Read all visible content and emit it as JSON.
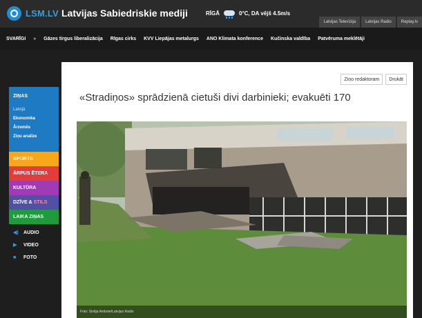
{
  "header": {
    "logo_text": "LSM.LV",
    "site_title": "Latvijas Sabiedriskie mediji",
    "weather_city": "RĪGĀ",
    "weather_info": "0°C, DA vējš 4.5m/s",
    "nav": [
      "Latvijas Televīzija",
      "Latvijas Radio",
      "Replay.lv"
    ]
  },
  "ticker": {
    "label": "SVARĪGI",
    "separator": "»",
    "items": [
      "Gāzes tirgus liberalizācija",
      "Rīgas cirks",
      "KVV Liepājas metalurgs",
      "ANO Klimata konference",
      "Kučinska valdība",
      "Patvēruma meklētāji"
    ]
  },
  "sidebar": {
    "zinas": "ZIŅAS",
    "zinas_sub": [
      "Latvijā",
      "Ekonomika",
      "Ārzemēs",
      "Ziņu analīze"
    ],
    "sports": "SPORTS",
    "arpus": "ĀRPUS ĒTERA",
    "kultura": "KULTŪRA",
    "dzive": "DZĪVE & ",
    "stils": "STILS",
    "laika": "LAIKA ZIŅAS",
    "audio": "AUDIO",
    "video": "VIDEO",
    "foto": "FOTO"
  },
  "article": {
    "tool_editor": "Ziņo redaktoram",
    "tool_print": "Drukāt",
    "headline": "«Stradiņos» sprādzienā cietuši divi darbinieki; evakuēti 170",
    "photo_caption": "Foto: Sintija Ambote/Latvijas Radio"
  },
  "icons": {
    "logo": "lsm-logo-icon",
    "weather": "cloud-rain-icon",
    "audio": "speaker-icon",
    "video": "play-icon",
    "foto": "camera-icon"
  }
}
